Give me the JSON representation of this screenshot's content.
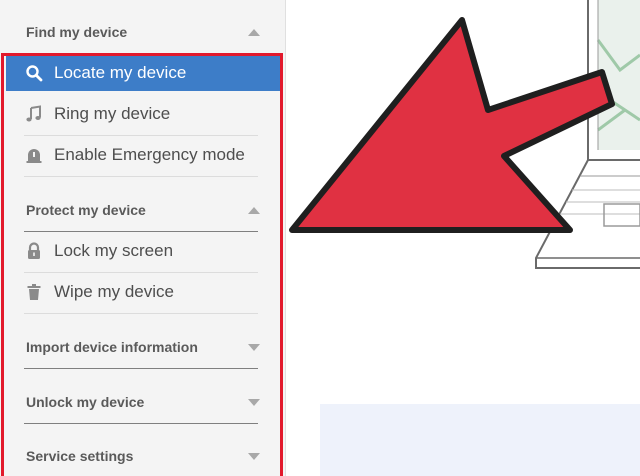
{
  "sidebar": {
    "sections": [
      {
        "title": "Find my device",
        "expanded": true
      },
      {
        "title": "Protect my device",
        "expanded": true
      },
      {
        "title": "Import device information",
        "expanded": false
      },
      {
        "title": "Unlock my device",
        "expanded": false
      },
      {
        "title": "Service settings",
        "expanded": false
      }
    ],
    "find_items": [
      {
        "label": "Locate my device",
        "icon": "search-icon",
        "active": true
      },
      {
        "label": "Ring my device",
        "icon": "music-note-icon",
        "active": false
      },
      {
        "label": "Enable Emergency mode",
        "icon": "emergency-icon",
        "active": false
      }
    ],
    "protect_items": [
      {
        "label": "Lock my screen",
        "icon": "lock-icon"
      },
      {
        "label": "Wipe my device",
        "icon": "trash-icon"
      }
    ]
  },
  "colors": {
    "accent": "#3d7dc8",
    "highlight_outline": "#e2192c",
    "arrow": "#e03142"
  }
}
